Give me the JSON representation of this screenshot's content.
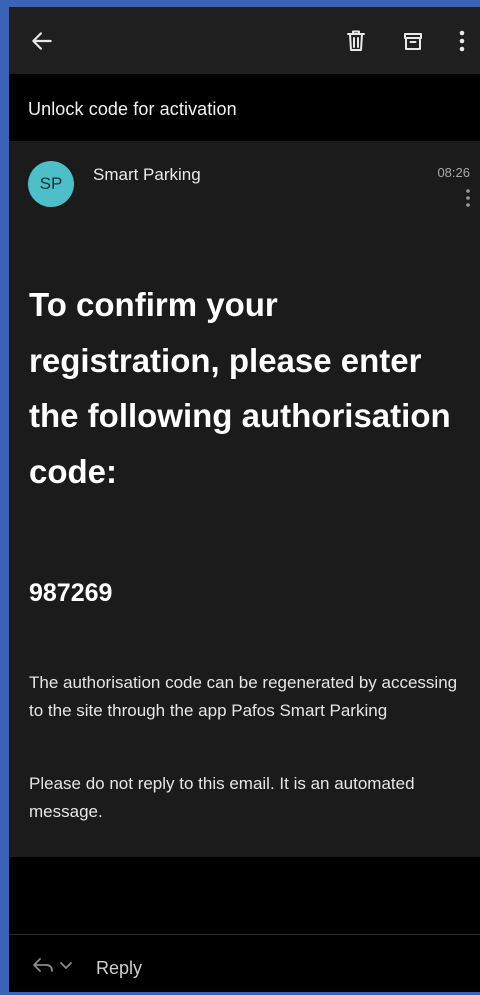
{
  "toolbar": {
    "icons": [
      "back-arrow-icon",
      "trash-icon",
      "archive-icon",
      "more-vertical-icon"
    ]
  },
  "email": {
    "subject": "Unlock code for activation",
    "avatar_initials": "SP",
    "sender": "Smart Parking",
    "time": "08:26",
    "headline": "To confirm your registration, please enter the following authorisation code:",
    "code": "987269",
    "body_paragraphs": [
      "The authorisation code can be regenerated by accessing to the site through the app Pafos Smart Parking",
      "Please do not reply to this email. It is an automated message."
    ]
  },
  "footer": {
    "reply_label": "Reply"
  },
  "colors": {
    "frame_border": "#3b64b8",
    "toolbar_bg": "#1f1f1f",
    "subject_bg": "#000000",
    "message_bg": "#1b1b1b",
    "avatar_bg": "#4dbfc9"
  }
}
